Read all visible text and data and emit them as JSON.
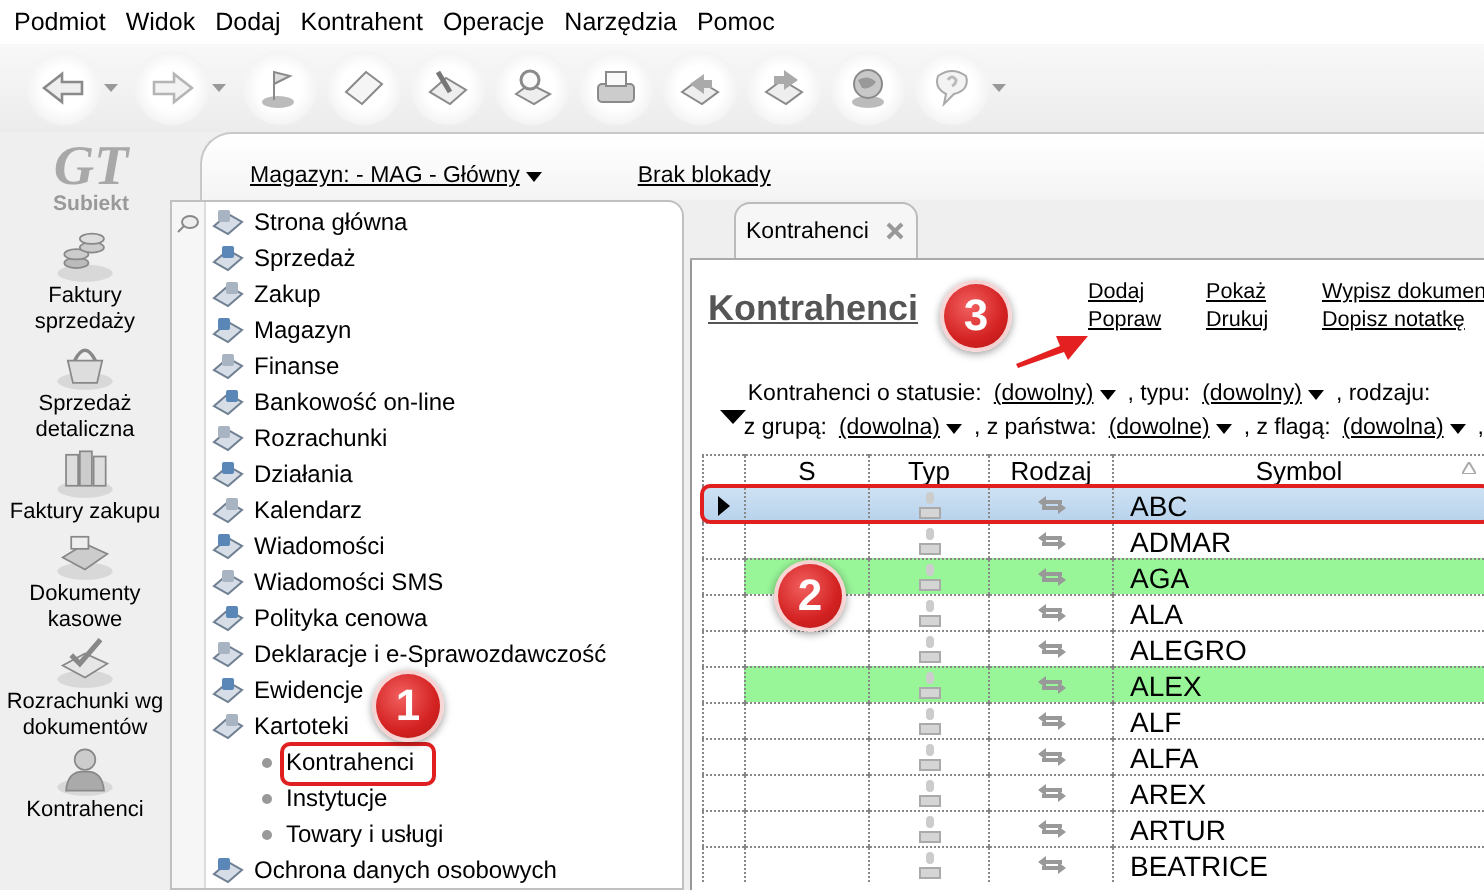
{
  "menu": [
    {
      "label": "Podmiot"
    },
    {
      "label": "Widok"
    },
    {
      "label": "Dodaj"
    },
    {
      "label": "Kontrahent"
    },
    {
      "label": "Operacje"
    },
    {
      "label": "Narzędzia"
    },
    {
      "label": "Pomoc"
    }
  ],
  "toolbar": [
    {
      "kind": "back",
      "dropdown": true
    },
    {
      "kind": "forward",
      "dropdown": true
    },
    {
      "kind": "flag",
      "dropdown": false
    },
    {
      "kind": "page",
      "dropdown": false
    },
    {
      "kind": "pen",
      "dropdown": false
    },
    {
      "kind": "magnifier",
      "dropdown": false
    },
    {
      "kind": "printer",
      "dropdown": false
    },
    {
      "kind": "export",
      "dropdown": false
    },
    {
      "kind": "import",
      "dropdown": false
    },
    {
      "kind": "globe",
      "dropdown": false
    },
    {
      "kind": "help",
      "dropdown": true
    }
  ],
  "logo": {
    "mark": "GT",
    "name": "Subiekt"
  },
  "nav": [
    {
      "label": "Faktury sprzedaży",
      "kind": "coins"
    },
    {
      "label": "Sprzedaż detaliczna",
      "kind": "basket"
    },
    {
      "label": "Faktury zakupu",
      "kind": "binders"
    },
    {
      "label": "Dokumenty kasowe",
      "kind": "register"
    },
    {
      "label": "Rozrachunki wg dokumentów",
      "kind": "check"
    },
    {
      "label": "Kontrahenci",
      "kind": "person"
    }
  ],
  "header": {
    "warehouse": "Magazyn: - MAG - Główny",
    "lock": "Brak blokady"
  },
  "tree": [
    {
      "label": "Strona główna"
    },
    {
      "label": "Sprzedaż"
    },
    {
      "label": "Zakup"
    },
    {
      "label": "Magazyn"
    },
    {
      "label": "Finanse"
    },
    {
      "label": "Bankowość on-line"
    },
    {
      "label": "Rozrachunki"
    },
    {
      "label": "Działania"
    },
    {
      "label": "Kalendarz"
    },
    {
      "label": "Wiadomości"
    },
    {
      "label": "Wiadomości SMS"
    },
    {
      "label": "Polityka cenowa"
    },
    {
      "label": "Deklaracje i e-Sprawozdawczość"
    },
    {
      "label": "Ewidencje"
    },
    {
      "label": "Kartoteki",
      "children": [
        {
          "label": "Kontrahenci"
        },
        {
          "label": "Instytucje"
        },
        {
          "label": "Towary i usługi"
        }
      ]
    },
    {
      "label": "Ochrona danych osobowych"
    }
  ],
  "tabs": [
    {
      "label": "Kontrahenci",
      "selected": true
    }
  ],
  "title": "Kontrahenci",
  "actions": [
    {
      "label": "Dodaj"
    },
    {
      "label": "Pokaż"
    },
    {
      "label": "Wypisz dokumen"
    },
    {
      "label": "Popraw"
    },
    {
      "label": "Drukuj"
    },
    {
      "label": "Dopisz notatkę"
    }
  ],
  "filters": [
    {
      "items": [
        {
          "label": "Kontrahenci o statusie:",
          "value": "(dowolny)"
        },
        {
          "label": ", typu:",
          "value": "(dowolny)"
        },
        {
          "label": ", rodzaju:"
        }
      ]
    },
    {
      "items": [
        {
          "label": "z grupą:",
          "value": "(dowolna)"
        },
        {
          "label": ", z państwa:",
          "value": "(dowolne)"
        },
        {
          "label": ", z flagą:",
          "value": "(dowolna)"
        },
        {
          "label": ","
        }
      ]
    }
  ],
  "table": {
    "columns": [
      "S",
      "Typ",
      "Rodzaj",
      "Symbol"
    ],
    "rows": [
      {
        "symbol": "ABC",
        "selected": true,
        "highlighted": false
      },
      {
        "symbol": "ADMAR",
        "selected": false,
        "highlighted": false
      },
      {
        "symbol": "AGA",
        "selected": false,
        "highlighted": true
      },
      {
        "symbol": "ALA",
        "selected": false,
        "highlighted": false
      },
      {
        "symbol": "ALEGRO",
        "selected": false,
        "highlighted": false
      },
      {
        "symbol": "ALEX",
        "selected": false,
        "highlighted": true
      },
      {
        "symbol": "ALF",
        "selected": false,
        "highlighted": false
      },
      {
        "symbol": "ALFA",
        "selected": false,
        "highlighted": false
      },
      {
        "symbol": "AREX",
        "selected": false,
        "highlighted": false
      },
      {
        "symbol": "ARTUR",
        "selected": false,
        "highlighted": false
      },
      {
        "symbol": "BEATRICE",
        "selected": false,
        "highlighted": false
      }
    ]
  },
  "callouts": [
    {
      "label": "1"
    },
    {
      "label": "2"
    },
    {
      "label": "3"
    }
  ]
}
